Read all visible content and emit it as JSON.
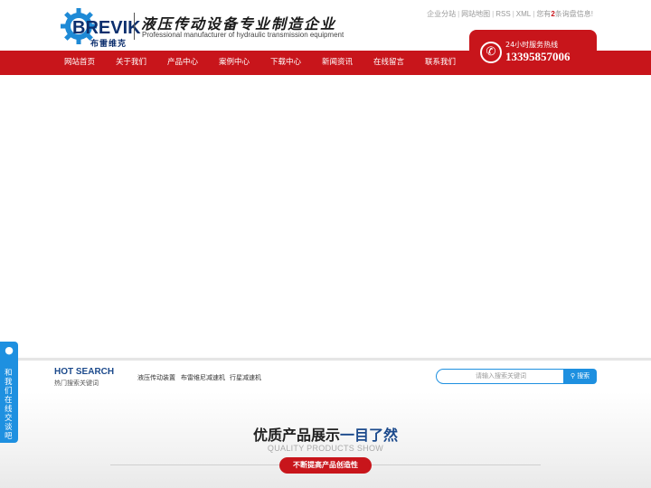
{
  "header": {
    "logo_word": "BREVIK",
    "logo_cn": "布雷维克",
    "slogan_cn": "液压传动设备专业制造企业",
    "slogan_en": "Professional manufacturer of hydraulic transmission equipment",
    "toplinks": [
      "企业分站",
      "网站地图",
      "RSS",
      "XML"
    ],
    "notice_prefix": "您有",
    "notice_count": "2",
    "notice_suffix": "条询盘信息!"
  },
  "hotline": {
    "label": "24小时服务热线",
    "number": "13395857006",
    "icon": "phone-icon"
  },
  "nav": {
    "items": [
      "网站首页",
      "关于我们",
      "产品中心",
      "案例中心",
      "下载中心",
      "新闻资讯",
      "在线留言",
      "联系我们"
    ]
  },
  "search": {
    "title": "HOT SEARCH",
    "subtitle": "热门搜索关键词",
    "keywords": [
      "液压传动装置",
      "布雷维尼减速机",
      "行星减速机"
    ],
    "placeholder": "请输入搜索关键词",
    "button_label": "搜索",
    "icon": "search-icon"
  },
  "products": {
    "title_prefix": "优质产品展示",
    "title_highlight": "一目了然",
    "title_en": "QUALITY PRODUCTS SHOW",
    "tag": "不断提高产品创造性"
  },
  "sidefloat": {
    "text": "和我们在线交谈吧",
    "icon": "chat-icon"
  },
  "colors": {
    "brand_red": "#c8151b",
    "brand_blue": "#1c4a8c",
    "accent_blue": "#1e90e0"
  }
}
